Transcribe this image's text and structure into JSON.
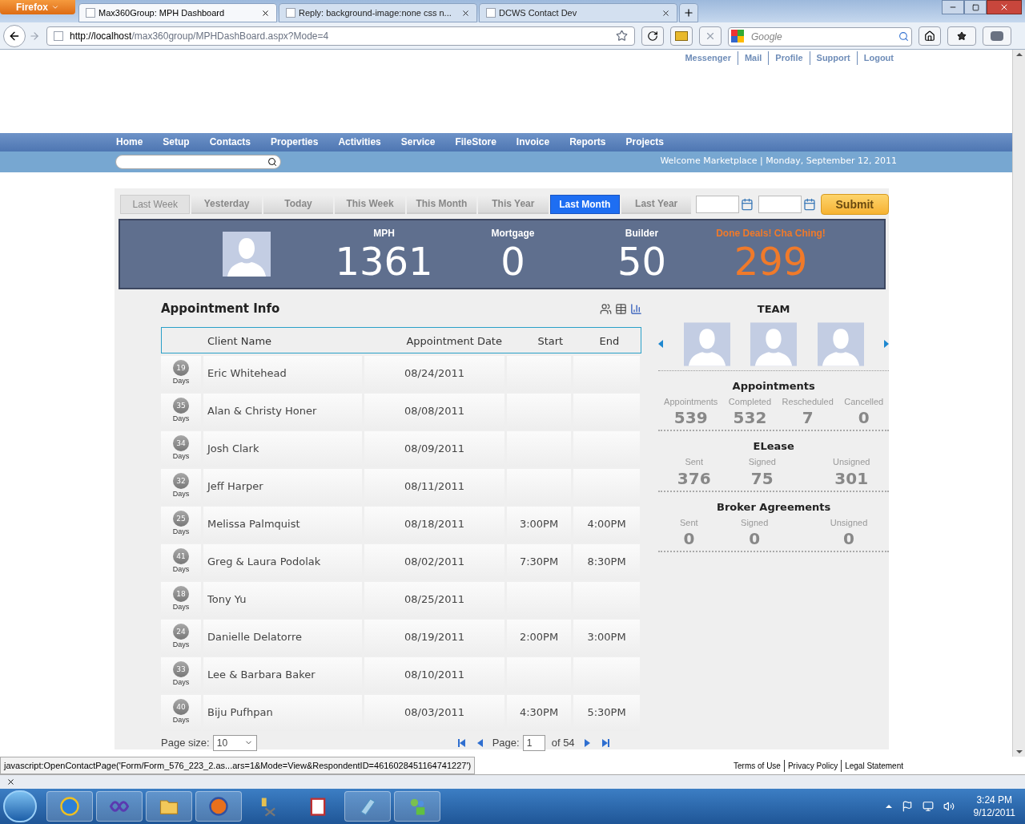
{
  "browser": {
    "menu_button": "Firefox",
    "tabs": [
      {
        "title": "Max360Group: MPH Dashboard",
        "selected": true
      },
      {
        "title": "Reply: background-image:none css n...",
        "selected": false
      },
      {
        "title": "DCWS Contact Dev",
        "selected": false
      }
    ],
    "url_host": "http://localhost",
    "url_path": "/max360group/MPHDashBoard.aspx?Mode=4",
    "search_placeholder": "Google"
  },
  "top_links": [
    "Messenger",
    "Mail",
    "Profile",
    "Support",
    "Logout"
  ],
  "nav_items": [
    "Home",
    "Setup",
    "Contacts",
    "Properties",
    "Activities",
    "Service",
    "FileStore",
    "Invoice",
    "Reports",
    "Projects"
  ],
  "welcome": "Welcome Marketplace | Monday, September 12, 2011",
  "date_filters": [
    {
      "label": "Last Week",
      "selected": false
    },
    {
      "label": "Yesterday",
      "selected": false
    },
    {
      "label": "Today",
      "selected": false
    },
    {
      "label": "This Week",
      "selected": false
    },
    {
      "label": "This Month",
      "selected": false
    },
    {
      "label": "This Year",
      "selected": false
    },
    {
      "label": "Last Month",
      "selected": true
    },
    {
      "label": "Last Year",
      "selected": false
    }
  ],
  "submit": "Submit",
  "stats": [
    {
      "label": "MPH",
      "value": "1361",
      "color": "#ffffff"
    },
    {
      "label": "Mortgage",
      "value": "0",
      "color": "#ffffff"
    },
    {
      "label": "Builder",
      "value": "50",
      "color": "#ffffff"
    },
    {
      "label": "Done Deals! Cha Ching!",
      "value": "299",
      "color": "#f07a2a"
    }
  ],
  "appointments": {
    "title": "Appointment Info",
    "columns": [
      "Client Name",
      "Appointment Date",
      "Start",
      "End"
    ],
    "rows": [
      {
        "days": "19",
        "unit": "Days",
        "client": "Eric Whitehead",
        "date": "08/24/2011"
      },
      {
        "days": "35",
        "unit": "Days",
        "client": "Alan & Christy Honer",
        "date": "08/08/2011"
      },
      {
        "days": "34",
        "unit": "Days",
        "client": "Josh Clark",
        "date": "08/09/2011"
      },
      {
        "days": "32",
        "unit": "Days",
        "client": "Jeff Harper",
        "date": "08/11/2011"
      },
      {
        "days": "25",
        "unit": "Days",
        "client": "Melissa Palmquist",
        "date": "08/18/2011",
        "start": "3:00PM",
        "end": "4:00PM"
      },
      {
        "days": "41",
        "unit": "Days",
        "client": "Greg & Laura Podolak",
        "date": "08/02/2011",
        "start": "7:30PM",
        "end": "8:30PM"
      },
      {
        "days": "18",
        "unit": "Days",
        "client": "Tony Yu",
        "date": "08/25/2011"
      },
      {
        "days": "24",
        "unit": "Days",
        "client": "Danielle Delatorre",
        "date": "08/19/2011",
        "start": "2:00PM",
        "end": "3:00PM"
      },
      {
        "days": "33",
        "unit": "Days",
        "client": "Lee & Barbara Baker",
        "date": "08/10/2011"
      },
      {
        "days": "40",
        "unit": "Days",
        "client": "Biju Pufhpan",
        "date": "08/03/2011",
        "start": "4:30PM",
        "end": "5:30PM"
      }
    ],
    "pager": {
      "size_label": "Page size:",
      "size": "10",
      "page_label": "Page:",
      "page": "1",
      "total": "of 54"
    }
  },
  "team": {
    "title": "TEAM",
    "sections": [
      {
        "title": "Appointments",
        "stats": [
          {
            "label": "Appointments",
            "value": "539"
          },
          {
            "label": "Completed",
            "value": "532"
          },
          {
            "label": "Rescheduled",
            "value": "7"
          },
          {
            "label": "Cancelled",
            "value": "0"
          }
        ]
      },
      {
        "title": "ELease",
        "stats": [
          {
            "label": "Sent",
            "value": "376"
          },
          {
            "label": "Signed",
            "value": "75"
          },
          {
            "label": "Unsigned",
            "value": "301"
          }
        ]
      },
      {
        "title": "Broker Agreements",
        "stats": [
          {
            "label": "Sent",
            "value": "0"
          },
          {
            "label": "Signed",
            "value": "0"
          },
          {
            "label": "Unsigned",
            "value": "0"
          }
        ]
      }
    ]
  },
  "status_text": "javascript:OpenContactPage('Form/Form_576_223_2.as...ars=1&Mode=View&RespondentID=4616028451164741227')",
  "footer_links": [
    "Terms of Use",
    "Privacy Policy",
    "Legal Statement"
  ],
  "taskbar": {
    "time": "3:24 PM",
    "date": "9/12/2011"
  }
}
